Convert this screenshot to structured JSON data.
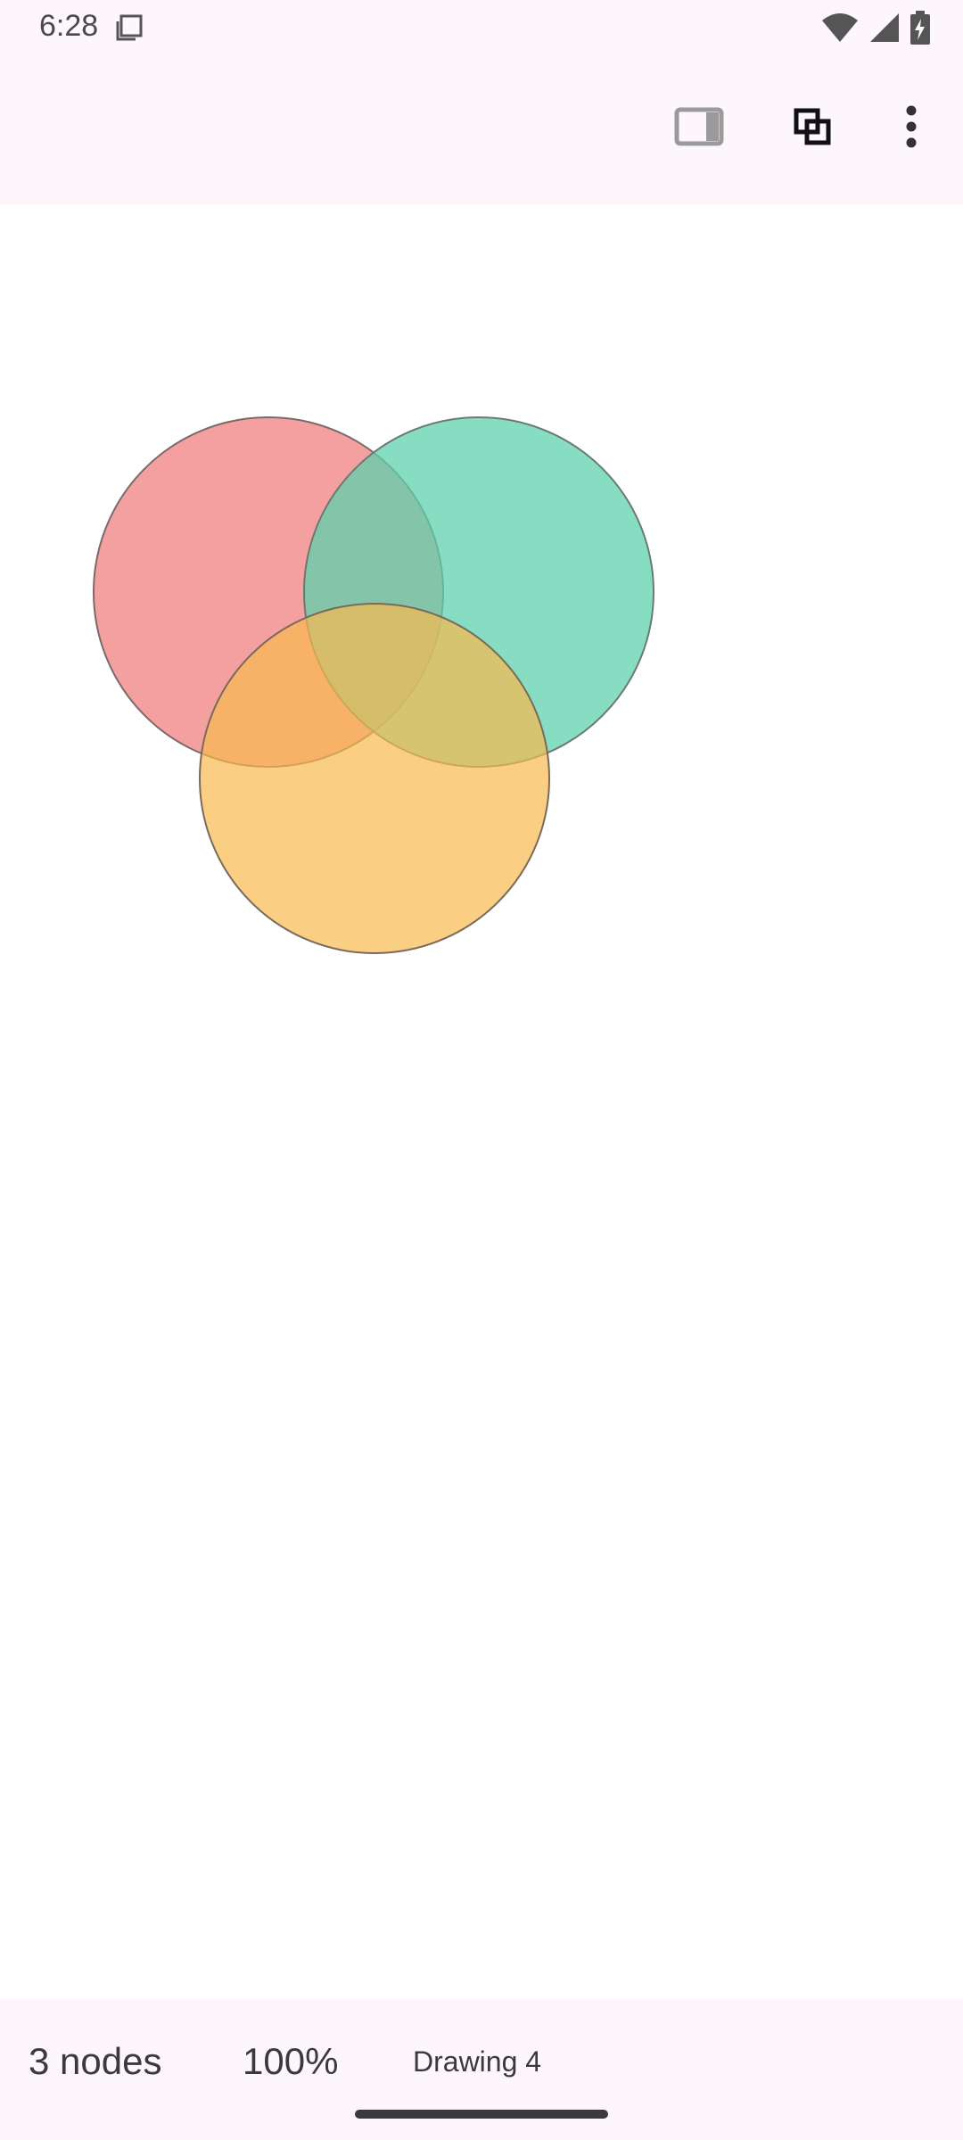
{
  "status_bar": {
    "time": "6:28",
    "icons": [
      "notification-copy-icon",
      "wifi-icon",
      "cellular-signal-icon",
      "battery-charging-icon"
    ]
  },
  "app_bar": {
    "actions": [
      "panel-toggle-icon",
      "layers-icon",
      "more-vert-icon"
    ]
  },
  "canvas": {
    "shapes": [
      {
        "name": "red-circle-node",
        "fill": "#f08080",
        "opacity": 0.75
      },
      {
        "name": "teal-circle-node",
        "fill": "#5fd2ad",
        "opacity": 0.75
      },
      {
        "name": "orange-circle-node",
        "fill": "#f8b94f",
        "opacity": 0.7
      }
    ]
  },
  "bottom_bar": {
    "node_count": "3 nodes",
    "zoom": "100%",
    "drawing_name": "Drawing 4"
  },
  "colors": {
    "surface": "#fdf6fd",
    "stroke": "#7a6a6a",
    "text": "#3a3a3a"
  }
}
